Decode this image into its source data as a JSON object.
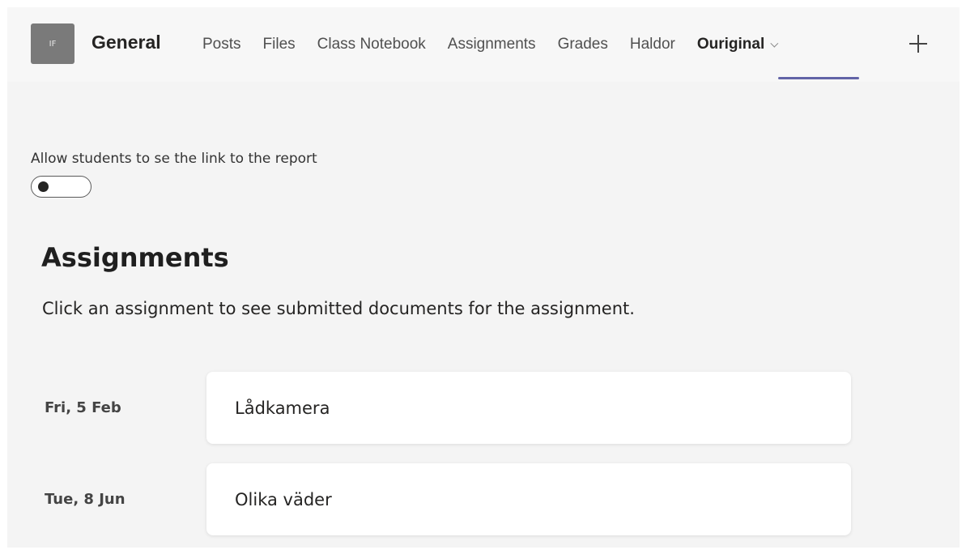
{
  "header": {
    "avatar_text": "IF",
    "channel_name": "General",
    "tabs": [
      {
        "label": "Posts"
      },
      {
        "label": "Files"
      },
      {
        "label": "Class Notebook"
      },
      {
        "label": "Assignments"
      },
      {
        "label": "Grades"
      },
      {
        "label": "Haldor"
      },
      {
        "label": "Ouriginal",
        "active": true
      }
    ],
    "accent_color": "#6264a7"
  },
  "settings": {
    "toggle_label": "Allow students to se the link to the report",
    "toggle_state": "off"
  },
  "assignments": {
    "title": "Assignments",
    "description": "Click an assignment to see submitted documents for the assignment.",
    "items": [
      {
        "date": "Fri, 5 Feb",
        "name": "Lådkamera"
      },
      {
        "date": "Tue, 8 Jun",
        "name": "Olika väder"
      }
    ]
  }
}
